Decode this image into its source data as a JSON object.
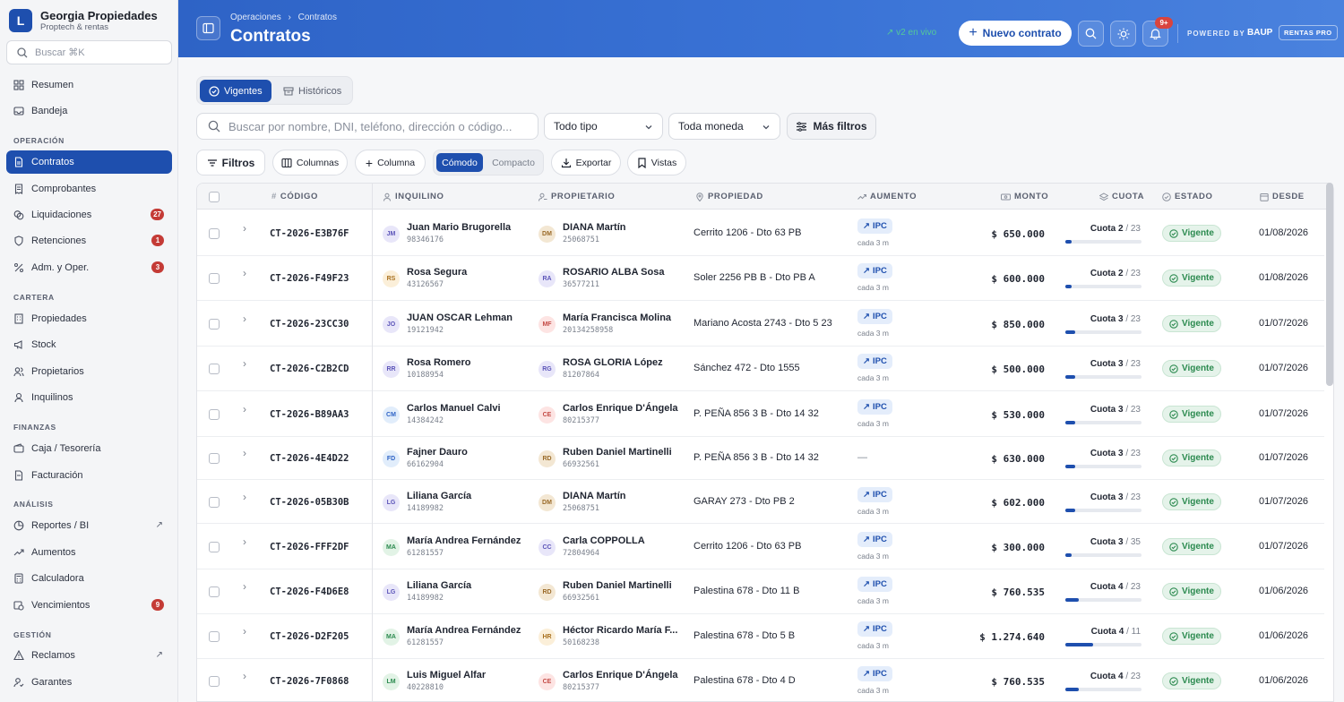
{
  "brand": {
    "logo_letter": "L",
    "name": "Georgia Propiedades",
    "subtitle": "Proptech & rentas"
  },
  "sidebar": {
    "search_placeholder": "Buscar ⌘K",
    "items": [
      {
        "label": "Resumen",
        "icon": "grid-icon"
      },
      {
        "label": "Bandeja",
        "icon": "inbox-icon"
      },
      {
        "label": "Contratos",
        "icon": "document-icon",
        "active": true
      },
      {
        "label": "Comprobantes",
        "icon": "receipt-icon"
      },
      {
        "label": "Liquidaciones",
        "icon": "coins-icon",
        "badge": "27"
      },
      {
        "label": "Retenciones",
        "icon": "shield-icon",
        "badge": "1"
      },
      {
        "label": "Adm. y Oper.",
        "icon": "percent-icon",
        "badge": "3"
      },
      {
        "label": "Propiedades",
        "icon": "building-icon"
      },
      {
        "label": "Stock",
        "icon": "megaphone-icon"
      },
      {
        "label": "Propietarios",
        "icon": "users-icon"
      },
      {
        "label": "Inquilinos",
        "icon": "user-icon"
      },
      {
        "label": "Caja / Tesorería",
        "icon": "wallet-icon"
      },
      {
        "label": "Facturación",
        "icon": "invoice-icon"
      },
      {
        "label": "Reportes / BI",
        "icon": "chart-icon",
        "external": "↗"
      },
      {
        "label": "Aumentos",
        "icon": "trend-icon"
      },
      {
        "label": "Calculadora",
        "icon": "calculator-icon"
      },
      {
        "label": "Vencimientos",
        "icon": "calendar-clock-icon",
        "badge": "9"
      },
      {
        "label": "Reclamos",
        "icon": "alert-icon",
        "external": "↗"
      },
      {
        "label": "Garantes",
        "icon": "user-check-icon"
      }
    ],
    "sections": [
      "OPERACIÓN",
      "CARTERA",
      "FINANZAS",
      "ANÁLISIS",
      "GESTIÓN"
    ]
  },
  "header": {
    "breadcrumb_parent": "Operaciones",
    "breadcrumb_sep": "›",
    "breadcrumb_current": "Contratos",
    "title": "Contratos",
    "live": "v2 en vivo",
    "new_button": "Nuevo contrato",
    "notif_badge": "9+",
    "powered_by": "POWERED BY",
    "powered_brand": "BAUP",
    "plan": "RENTAS PRO"
  },
  "tabs": {
    "active": "Vigentes",
    "inactive": "Históricos"
  },
  "filters": {
    "search_placeholder": "Buscar por nombre, DNI, teléfono, dirección o código...",
    "type": "Todo tipo",
    "currency": "Toda moneda",
    "more": "Más filtros"
  },
  "toolbar": {
    "filters": "Filtros",
    "columns": "Columnas",
    "add_column": "Columna",
    "density_on": "Cómodo",
    "density_off": "Compacto",
    "export": "Exportar",
    "views": "Vistas"
  },
  "table": {
    "headers": {
      "code": "CÓDIGO",
      "tenant": "INQUILINO",
      "owner": "PROPIETARIO",
      "property": "PROPIEDAD",
      "increase": "AUMENTO",
      "amount": "MONTO",
      "installment": "CUOTA",
      "status": "ESTADO",
      "since": "DESDE"
    },
    "rows": [
      {
        "code": "CT-2026-E3B76F",
        "tenant": "Juan Mario Brugorella",
        "tenant_id": "98346176",
        "tenant_initials": "JM",
        "owner": "DIANA Martín",
        "owner_id": "25068751",
        "owner_initials": "DM",
        "property": "Cerrito 1206 - Dto 63 PB",
        "increase": "IPC",
        "increase_sub": "cada 3 m",
        "amount": "$ 650.000",
        "cuota": "Cuota 2",
        "cuota_total": "/ 23",
        "progress": 0.087,
        "status": "Vigente",
        "since": "01/08/2026"
      },
      {
        "code": "CT-2026-F49F23",
        "tenant": "Rosa Segura",
        "tenant_id": "43126567",
        "tenant_initials": "RS",
        "owner": "ROSARIO ALBA Sosa",
        "owner_id": "36577211",
        "owner_initials": "RA",
        "property": "Soler 2256 PB B - Dto PB A",
        "increase": "IPC",
        "increase_sub": "cada 3 m",
        "amount": "$ 600.000",
        "cuota": "Cuota 2",
        "cuota_total": "/ 23",
        "progress": 0.087,
        "status": "Vigente",
        "since": "01/08/2026"
      },
      {
        "code": "CT-2026-23CC30",
        "tenant": "JUAN OSCAR Lehman",
        "tenant_id": "19121942",
        "tenant_initials": "JO",
        "owner": "María Francisca Molina",
        "owner_id": "20134258958",
        "owner_initials": "MF",
        "property": "Mariano Acosta 2743 - Dto 5 23",
        "increase": "IPC",
        "increase_sub": "cada 3 m",
        "amount": "$ 850.000",
        "cuota": "Cuota 3",
        "cuota_total": "/ 23",
        "progress": 0.13,
        "status": "Vigente",
        "since": "01/07/2026"
      },
      {
        "code": "CT-2026-C2B2CD",
        "tenant": "Rosa Romero",
        "tenant_id": "10188954",
        "tenant_initials": "RR",
        "owner": "ROSA GLORIA López",
        "owner_id": "81207864",
        "owner_initials": "RG",
        "property": "Sánchez 472 - Dto 1555",
        "increase": "IPC",
        "increase_sub": "cada 3 m",
        "amount": "$ 500.000",
        "cuota": "Cuota 3",
        "cuota_total": "/ 23",
        "progress": 0.13,
        "status": "Vigente",
        "since": "01/07/2026"
      },
      {
        "code": "CT-2026-B89AA3",
        "tenant": "Carlos Manuel Calvi",
        "tenant_id": "14384242",
        "tenant_initials": "CM",
        "owner": "Carlos Enrique D'Ángela",
        "owner_id": "80215377",
        "owner_initials": "CE",
        "property": "P. PEÑA 856 3 B - Dto 14 32",
        "increase": "IPC",
        "increase_sub": "cada 3 m",
        "amount": "$ 530.000",
        "cuota": "Cuota 3",
        "cuota_total": "/ 23",
        "progress": 0.13,
        "status": "Vigente",
        "since": "01/07/2026"
      },
      {
        "code": "CT-2026-4E4D22",
        "tenant": "Fajner Dauro",
        "tenant_id": "66162904",
        "tenant_initials": "FD",
        "owner": "Ruben Daniel Martinelli",
        "owner_id": "66932561",
        "owner_initials": "RD",
        "property": "P. PEÑA 856 3 B - Dto 14 32",
        "increase": "—",
        "increase_sub": "",
        "amount": "$ 630.000",
        "cuota": "Cuota 3",
        "cuota_total": "/ 23",
        "progress": 0.13,
        "status": "Vigente",
        "since": "01/07/2026"
      },
      {
        "code": "CT-2026-05B30B",
        "tenant": "Liliana García",
        "tenant_id": "14189982",
        "tenant_initials": "LG",
        "owner": "DIANA Martín",
        "owner_id": "25068751",
        "owner_initials": "DM",
        "property": "GARAY 273 - Dto PB 2",
        "increase": "IPC",
        "increase_sub": "cada 3 m",
        "amount": "$ 602.000",
        "cuota": "Cuota 3",
        "cuota_total": "/ 23",
        "progress": 0.13,
        "status": "Vigente",
        "since": "01/07/2026"
      },
      {
        "code": "CT-2026-FFF2DF",
        "tenant": "María Andrea Fernández",
        "tenant_id": "61281557",
        "tenant_initials": "MA",
        "owner": "Carla COPPOLLA",
        "owner_id": "72804964",
        "owner_initials": "CC",
        "property": "Cerrito 1206 - Dto 63 PB",
        "increase": "IPC",
        "increase_sub": "cada 3 m",
        "amount": "$ 300.000",
        "cuota": "Cuota 3",
        "cuota_total": "/ 35",
        "progress": 0.086,
        "status": "Vigente",
        "since": "01/07/2026"
      },
      {
        "code": "CT-2026-F4D6E8",
        "tenant": "Liliana García",
        "tenant_id": "14189982",
        "tenant_initials": "LG",
        "owner": "Ruben Daniel Martinelli",
        "owner_id": "66932561",
        "owner_initials": "RD",
        "property": "Palestina 678 - Dto 11 B",
        "increase": "IPC",
        "increase_sub": "cada 3 m",
        "amount": "$ 760.535",
        "cuota": "Cuota 4",
        "cuota_total": "/ 23",
        "progress": 0.174,
        "status": "Vigente",
        "since": "01/06/2026"
      },
      {
        "code": "CT-2026-D2F205",
        "tenant": "María Andrea Fernández",
        "tenant_id": "61281557",
        "tenant_initials": "MA",
        "owner": "Héctor Ricardo María F...",
        "owner_id": "50168238",
        "owner_initials": "HR",
        "property": "Palestina 678 - Dto 5 B",
        "increase": "IPC",
        "increase_sub": "cada 3 m",
        "amount": "$ 1.274.640",
        "cuota": "Cuota 4",
        "cuota_total": "/ 11",
        "progress": 0.364,
        "status": "Vigente",
        "since": "01/06/2026"
      },
      {
        "code": "CT-2026-7F0868",
        "tenant": "Luis Miguel Alfar",
        "tenant_id": "40228810",
        "tenant_initials": "LM",
        "owner": "Carlos Enrique D'Ángela",
        "owner_id": "80215377",
        "owner_initials": "CE",
        "property": "Palestina 678 - Dto 4 D",
        "increase": "IPC",
        "increase_sub": "cada 3 m",
        "amount": "$ 760.535",
        "cuota": "Cuota 4",
        "cuota_total": "/ 23",
        "progress": 0.174,
        "status": "Vigente",
        "since": "01/06/2026"
      }
    ]
  },
  "colors": {
    "accent": "#1e4fae",
    "status_green": "#2b8a4f",
    "badge_red": "#c43b36"
  }
}
